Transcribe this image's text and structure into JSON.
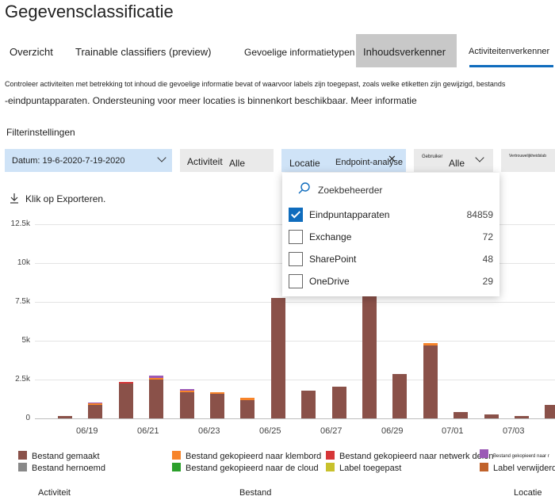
{
  "page": {
    "title": "Gegevensclassificatie",
    "tabs": [
      {
        "label": "Overzicht"
      },
      {
        "label": "Trainable classifiers (preview)"
      },
      {
        "label": "Gevoelige informatietypen"
      },
      {
        "label": "Inhoudsverkenner"
      },
      {
        "label": "Activiteitenverkenner"
      }
    ],
    "description_line1": "Controleer activiteiten met betrekking tot inhoud die gevoelige informatie bevat of waarvoor labels zijn toegepast, zoals welke etiketten zijn gewijzigd, bestands",
    "description_line2": "-eindpuntapparaten. Ondersteuning voor meer locaties is binnenkort beschikbaar. Meer informatie"
  },
  "filters": {
    "label": "Filterinstellingen",
    "date": "Datum: 19-6-2020-7-19-2020",
    "activity_label": "Activiteit",
    "activity_value": "Alle",
    "location_label": "Locatie",
    "location_value": "Endpoint-analyse",
    "user_label": "Gebruiker",
    "user_value": "Alle",
    "sensitivity_label": "Vertrouwelijkheidslab"
  },
  "dropdown": {
    "search_placeholder": "Zoekbeheerder",
    "items": [
      {
        "label": "Eindpuntapparaten",
        "count": "84859",
        "checked": true
      },
      {
        "label": "Exchange",
        "count": "72",
        "checked": false
      },
      {
        "label": "SharePoint",
        "count": "48",
        "checked": false
      },
      {
        "label": "OneDrive",
        "count": "29",
        "checked": false
      }
    ]
  },
  "export": {
    "label": "Klik op Exporteren."
  },
  "chart_data": {
    "type": "bar",
    "stacked": true,
    "yticks": [
      "0",
      "2.5k",
      "5k",
      "7.5k",
      "10k",
      "12.5k"
    ],
    "ylim": [
      0,
      12500
    ],
    "xticks": [
      "06/19",
      "06/21",
      "06/23",
      "06/25",
      "06/27",
      "06/29",
      "07/01",
      "07/03"
    ],
    "categories": [
      "06/18",
      "06/19",
      "06/20",
      "06/21",
      "06/22",
      "06/23",
      "06/24",
      "06/25",
      "06/26",
      "06/27",
      "06/28",
      "06/29",
      "06/30",
      "07/01",
      "07/02",
      "07/03",
      "07/04"
    ],
    "series": [
      {
        "name": "Bestand gemaakt",
        "color": "#8a5149",
        "values": [
          150,
          850,
          2250,
          2500,
          1700,
          1600,
          1150,
          7750,
          1800,
          2050,
          7900,
          2850,
          4700,
          400,
          280,
          150,
          850
        ]
      },
      {
        "name": "Bestand gekopieerd naar klembord",
        "color": "#f7842a",
        "values": [
          0,
          120,
          0,
          80,
          100,
          60,
          170,
          0,
          0,
          0,
          0,
          0,
          150,
          0,
          0,
          0,
          0
        ]
      },
      {
        "name": "Bestand gekopieerd naar netwerk delen",
        "color": "#d63638",
        "values": [
          0,
          0,
          120,
          0,
          0,
          0,
          0,
          0,
          0,
          0,
          0,
          0,
          0,
          0,
          0,
          0,
          0
        ]
      },
      {
        "name": "Bestand gekopieerd naar r",
        "color": "#9b59b6",
        "values": [
          0,
          60,
          0,
          180,
          100,
          0,
          0,
          0,
          0,
          0,
          0,
          0,
          0,
          0,
          0,
          0,
          0
        ]
      },
      {
        "name": "Bestand hernoemd",
        "color": "#888888",
        "values": [
          0,
          0,
          0,
          0,
          0,
          0,
          0,
          0,
          0,
          0,
          0,
          0,
          0,
          0,
          0,
          0,
          0
        ]
      },
      {
        "name": "Bestand gekopieerd naar de cloud",
        "color": "#2ca02c",
        "values": [
          0,
          0,
          0,
          0,
          0,
          0,
          0,
          0,
          0,
          0,
          0,
          0,
          0,
          0,
          0,
          0,
          0
        ]
      },
      {
        "name": "Label toegepast",
        "color": "#c8c12c",
        "values": [
          0,
          0,
          0,
          0,
          0,
          0,
          0,
          0,
          0,
          0,
          0,
          0,
          0,
          0,
          0,
          0,
          0
        ]
      },
      {
        "name": "Label verwijderd",
        "color": "#c0622b",
        "values": [
          0,
          0,
          0,
          0,
          0,
          0,
          0,
          0,
          0,
          0,
          0,
          0,
          0,
          0,
          0,
          0,
          0
        ]
      }
    ]
  },
  "bottom_columns": [
    "Activiteit",
    "Bestand",
    "Locatie"
  ]
}
